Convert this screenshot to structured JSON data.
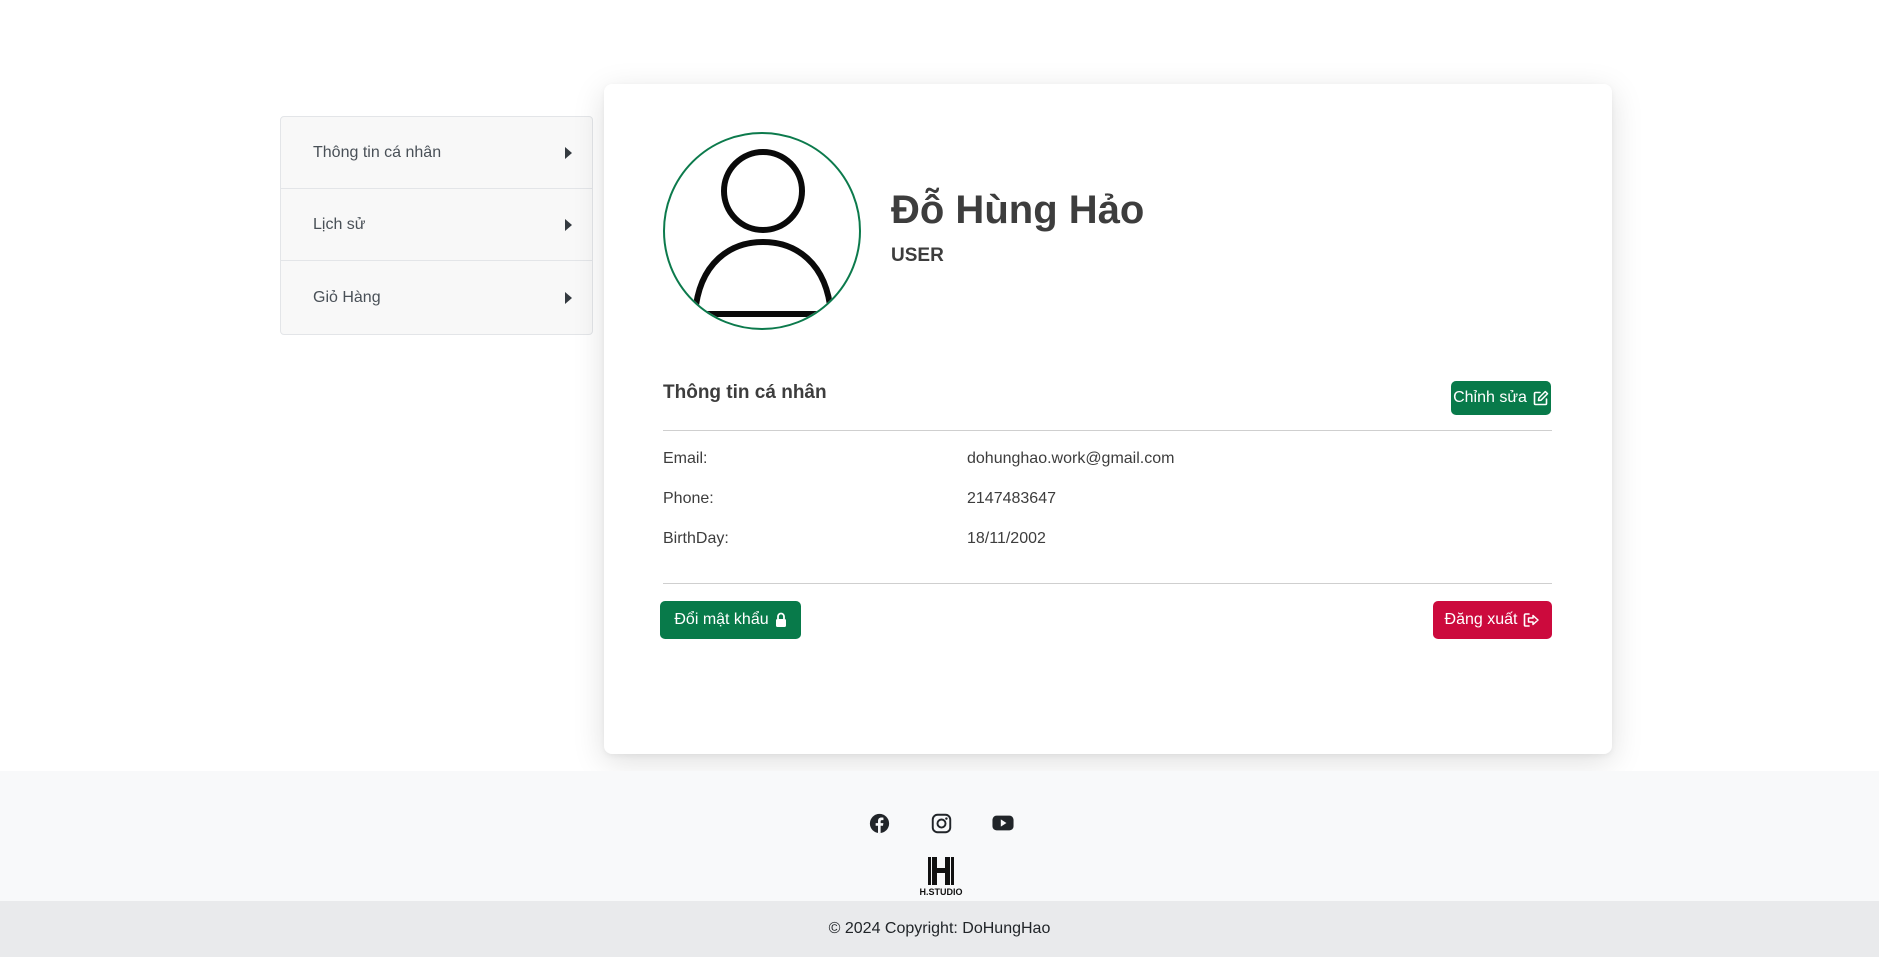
{
  "sidebar": {
    "items": [
      {
        "label": "Thông tin cá nhân"
      },
      {
        "label": "Lịch sử"
      },
      {
        "label": "Giỏ Hàng"
      }
    ]
  },
  "profile": {
    "name": "Đỗ Hùng Hảo",
    "role": "USER"
  },
  "info_section": {
    "title": "Thông tin cá nhân",
    "edit_label": "Chỉnh sửa",
    "fields": [
      {
        "label": "Email:",
        "value": "dohunghao.work@gmail.com"
      },
      {
        "label": "Phone:",
        "value": "2147483647"
      },
      {
        "label": "BirthDay:",
        "value": "18/11/2002"
      }
    ]
  },
  "actions": {
    "change_password_label": "Đổi mật khẩu",
    "logout_label": "Đăng xuất"
  },
  "footer": {
    "socials": [
      "facebook-icon",
      "instagram-icon",
      "youtube-icon"
    ],
    "logo_text": "H.STUDIO",
    "copyright": "© 2024 Copyright: DoHungHao"
  },
  "colors": {
    "primary": "#087a4a",
    "danger": "#cc0a3d",
    "footer_bg": "#f8f9fa",
    "copyright_bg": "#e9eaec"
  }
}
